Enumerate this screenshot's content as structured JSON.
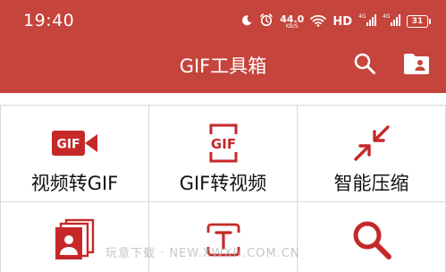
{
  "status_bar": {
    "time": "19:40",
    "net_speed_value": "44.0",
    "net_speed_unit": "KB/S",
    "hd_label": "HD",
    "battery_level": "31",
    "icons": [
      "moon-icon",
      "alarm-icon",
      "wifi-icon",
      "signal-4g-icon",
      "signal-4g-icon",
      "battery-icon"
    ]
  },
  "app_bar": {
    "title": "GIF工具箱",
    "actions": [
      "search-icon",
      "folder-person-icon"
    ]
  },
  "tools": [
    {
      "label": "视频转GIF",
      "icon": "video-to-gif-icon"
    },
    {
      "label": "GIF转视频",
      "icon": "gif-to-video-icon"
    },
    {
      "label": "智能压缩",
      "icon": "compress-icon"
    },
    {
      "label": "",
      "icon": "image-stack-icon"
    },
    {
      "label": "",
      "icon": "text-icon"
    },
    {
      "label": "",
      "icon": "search-icon"
    }
  ],
  "watermark": "玩意下载 · NEW.XWXH.COM.CN",
  "colors": {
    "primary": "#c5443b",
    "accent_icon": "#c62828",
    "text": "#111111",
    "divider": "#d8d8d8"
  }
}
